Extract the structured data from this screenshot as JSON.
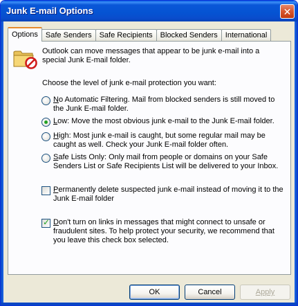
{
  "window": {
    "title": "Junk E-mail Options",
    "close_glyph": "✕"
  },
  "tabs": [
    {
      "label": "Options",
      "active": true
    },
    {
      "label": "Safe Senders",
      "active": false
    },
    {
      "label": "Safe Recipients",
      "active": false
    },
    {
      "label": "Blocked Senders",
      "active": false
    },
    {
      "label": "International",
      "active": false
    }
  ],
  "options_panel": {
    "icon": "junk-folder-icon",
    "intro": "Outlook can move messages that appear to be junk e-mail into a special Junk E-mail folder.",
    "prompt": "Choose the level of junk e-mail protection you want:",
    "levels": [
      {
        "accel": "N",
        "rest": "o Automatic Filtering.  Mail from blocked senders is still moved to the Junk E-mail folder.",
        "selected": false
      },
      {
        "accel": "L",
        "rest": "ow: Move the most obvious junk e-mail to the Junk E-mail folder.",
        "selected": true
      },
      {
        "accel": "H",
        "rest": "igh: Most junk e-mail is caught, but some regular mail may be caught as well. Check your Junk E-mail folder often.",
        "selected": false
      },
      {
        "accel": "S",
        "rest": "afe Lists Only: Only mail from people or domains on your Safe Senders List or Safe Recipients List will be delivered to your Inbox.",
        "selected": false
      }
    ],
    "delete_option": {
      "accel": "P",
      "rest": "ermanently delete suspected junk e-mail instead of moving it to the Junk E-mail folder",
      "checked": false
    },
    "links_option": {
      "accel": "D",
      "rest": "on't turn on links in messages that might connect to unsafe or fraudulent sites.  To help protect your security, we recommend that you leave this check box selected.",
      "checked": true
    }
  },
  "buttons": {
    "ok": "OK",
    "cancel": "Cancel",
    "apply": "Apply"
  },
  "colors": {
    "titlebar": "#0553d2",
    "dialog_bg": "#ece9d8",
    "panel_bg": "#fcfcfe",
    "active_tab_accent": "#e68b2c",
    "check_green": "#21a121"
  }
}
